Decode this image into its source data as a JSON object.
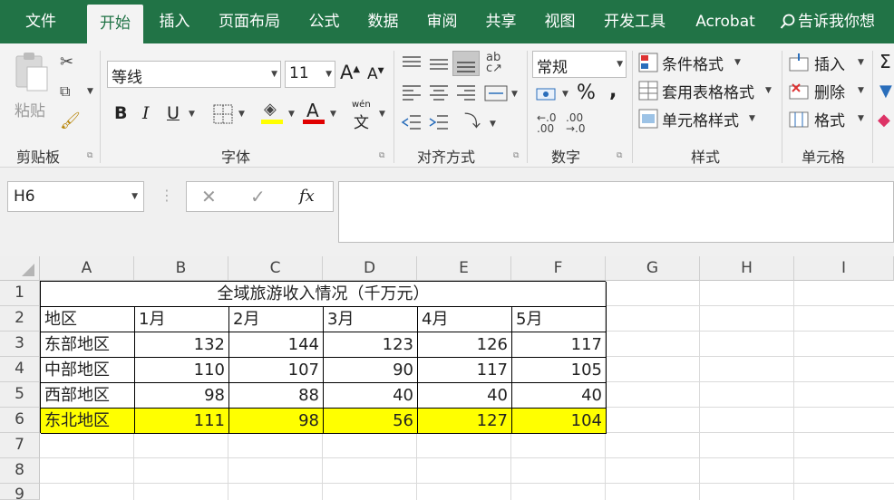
{
  "menu": {
    "tabs": [
      "文件",
      "开始",
      "插入",
      "页面布局",
      "公式",
      "数据",
      "审阅",
      "共享",
      "视图",
      "开发工具",
      "Acrobat"
    ],
    "active_tab": "开始",
    "tell_me": "告诉我你想"
  },
  "ribbon": {
    "clipboard": {
      "paste": "粘贴",
      "label": "剪贴板"
    },
    "font": {
      "name": "等线",
      "size": "11",
      "label": "字体",
      "bold": "B",
      "italic": "I",
      "underline": "U",
      "grow": "A",
      "shrink": "A",
      "wen": "wén",
      "wen_char": "文"
    },
    "alignment": {
      "label": "对齐方式"
    },
    "number": {
      "format": "常规",
      "percent": "%",
      "comma": ",",
      "inc": "←.0\n.00",
      "dec": ".00\n→.0",
      "label": "数字"
    },
    "styles": {
      "conditional": "条件格式",
      "table": "套用表格格式",
      "cell_styles": "单元格样式",
      "label": "样式"
    },
    "cells": {
      "insert": "插入",
      "delete": "删除",
      "format": "格式",
      "label": "单元格"
    },
    "fx": "fx"
  },
  "namebox": "H6",
  "columns": [
    "A",
    "B",
    "C",
    "D",
    "E",
    "F",
    "G",
    "H",
    "I"
  ],
  "rows": [
    "1",
    "2",
    "3",
    "4",
    "5",
    "6",
    "7",
    "8",
    "9"
  ],
  "sheet": {
    "title": "全域旅游收入情况（千万元）",
    "header": [
      "地区",
      "1月",
      "2月",
      "3月",
      "4月",
      "5月"
    ],
    "data": [
      [
        "东部地区",
        "132",
        "144",
        "123",
        "126",
        "117"
      ],
      [
        "中部地区",
        "110",
        "107",
        "90",
        "117",
        "105"
      ],
      [
        "西部地区",
        "98",
        "88",
        "40",
        "40",
        "40"
      ],
      [
        "东北地区",
        "111",
        "98",
        "56",
        "127",
        "104"
      ]
    ],
    "highlight_color": "#ffff00"
  }
}
